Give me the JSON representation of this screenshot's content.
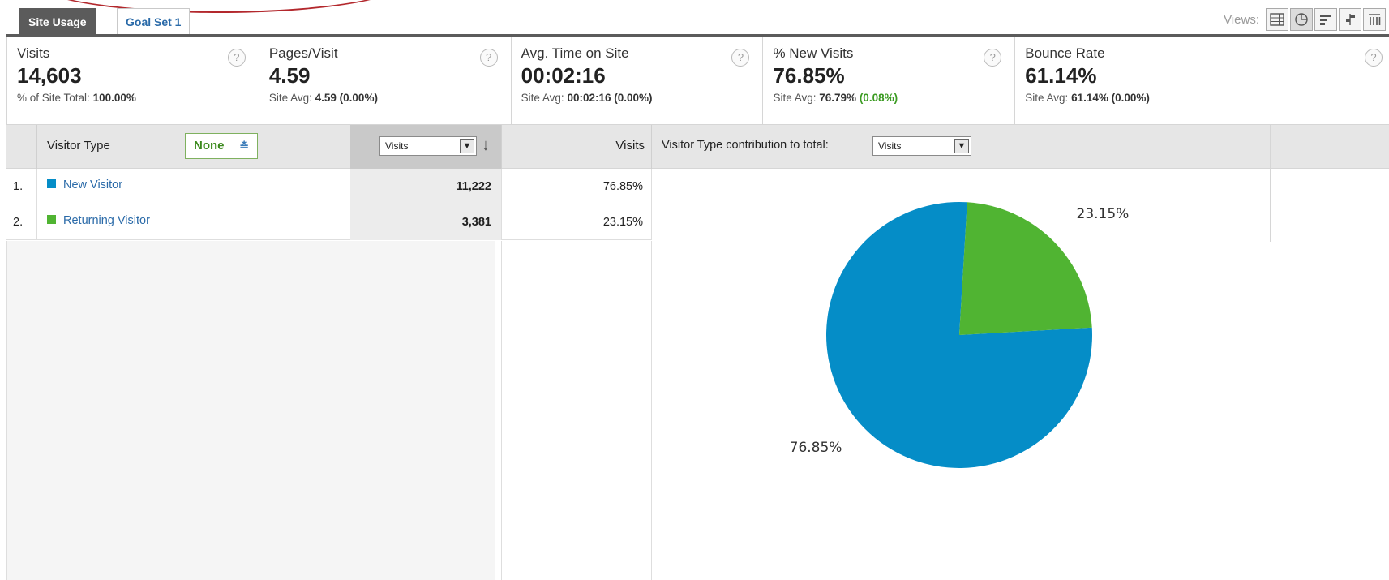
{
  "tabs": [
    {
      "label": "Site Usage",
      "active": true
    },
    {
      "label": "Goal Set 1",
      "active": false
    }
  ],
  "views": {
    "label": "Views:",
    "buttons": [
      "table-view-icon",
      "pie-view-icon",
      "performance-view-icon",
      "comparison-view-icon",
      "pivot-view-icon"
    ],
    "selected": "pie-view-icon"
  },
  "metrics": [
    {
      "label": "Visits",
      "value": "14,603",
      "sub_prefix": "% of Site Total:",
      "sub_value": "100.00%",
      "sub_change": ""
    },
    {
      "label": "Pages/Visit",
      "value": "4.59",
      "sub_prefix": "Site Avg:",
      "sub_value": "4.59",
      "sub_change": "(0.00%)"
    },
    {
      "label": "Avg. Time on Site",
      "value": "00:02:16",
      "sub_prefix": "Site Avg:",
      "sub_value": "00:02:16",
      "sub_change": "(0.00%)"
    },
    {
      "label": "% New Visits",
      "value": "76.85%",
      "sub_prefix": "Site Avg:",
      "sub_value": "76.79%",
      "sub_change": "(0.08%)"
    },
    {
      "label": "Bounce Rate",
      "value": "61.14%",
      "sub_prefix": "Site Avg:",
      "sub_value": "61.14%",
      "sub_change": "(0.00%)"
    }
  ],
  "help_symbol": "?",
  "table": {
    "dimension_header": "Visitor Type",
    "secondary_dimension": "None",
    "sort_metric": "Visits",
    "percent_column_header": "Visits",
    "contribution_label": "Visitor Type contribution to total:",
    "contribution_metric": "Visits",
    "rows": [
      {
        "num": "1.",
        "name": "New Visitor",
        "visits": "11,222",
        "percent": "76.85%",
        "color": "#058dc7"
      },
      {
        "num": "2.",
        "name": "Returning Visitor",
        "visits": "3,381",
        "percent": "23.15%",
        "color": "#50b432"
      }
    ]
  },
  "chart_data": {
    "type": "pie",
    "categories": [
      "New Visitor",
      "Returning Visitor"
    ],
    "values": [
      76.85,
      23.15
    ],
    "labels": [
      "76.85%",
      "23.15%"
    ],
    "colors": [
      "#058dc7",
      "#50b432"
    ]
  }
}
